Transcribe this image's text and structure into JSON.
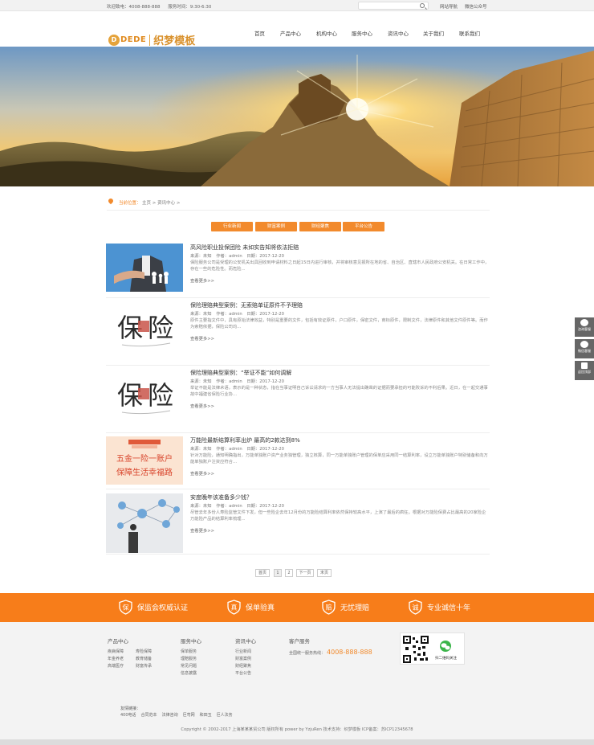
{
  "topbar": {
    "hotline_label": "欢迎致电：4008-888-888",
    "hours_label": "服务时间：9:30-6:30",
    "sitemap": "网站导航",
    "wechat": "微信公众号"
  },
  "header": {
    "logo_badge": "D",
    "logo_en": "DEDE",
    "logo_cn": "织梦模板"
  },
  "nav": [
    "首页",
    "产品中心",
    "机构中心",
    "服务中心",
    "资讯中心",
    "关于我们",
    "联系我们"
  ],
  "breadcrumb": {
    "label": "当前位置：",
    "path": "主页 > 资讯中心 >"
  },
  "categories": [
    "行业新闻",
    "财富案例",
    "财经聚焦",
    "平台公告"
  ],
  "articles": [
    {
      "title": "高风险职业投保团险 未如实告知将依法拒赔",
      "source": "来源：未知",
      "author": "作者：admin",
      "date": "日期：2017-12-20",
      "desc": "保险服务公司是受理的公安机关出具回收到申请材料之日起15日内进行审核，并将审核意见报所在地的省、自治区、直辖市人民政府公安机关。在日常工作中，存在一些的危险性。而危险...",
      "more": "查看更多>>"
    },
    {
      "title": "保险理赔典型案例：无索赔单证原件不予理赔",
      "source": "来源：未知",
      "author": "作者：admin",
      "date": "日期：2017-12-20",
      "desc": "原件主要指文件中，具有原始法律效益，特别是重要的文件，包括有效证原件，户口原件，保密文件，商标原件，限制文件，法律原件和其他文件原件等。而作为索赔依据，保险公司均...",
      "more": "查看更多>>"
    },
    {
      "title": "保险理赔典型案例：“举证不能”如何调解",
      "source": "来源：未知",
      "author": "作者：admin",
      "date": "日期：2017-12-20",
      "desc": "举证不能是法律术语，表示的是一种状态，指在当事证明自己诉讼请求的一方当事人无法提出确凿的证据而要承担的可能败诉的不利后果。近日，在一起交通事故中福建省保险行业协...",
      "more": "查看更多>>"
    },
    {
      "title": "万能险最新结算利率出炉 最高的2款达到8%",
      "source": "来源：未知",
      "author": "作者：admin",
      "date": "日期：2017-12-20",
      "desc": "针对万能险，通知明确指出，万能单独账户资产业务独管理，独立核算，同一万能单独账户管理的保单应采用同一结算利率，设立万能单独账户特别储备和向万能单独账户注资应符合...",
      "more": "查看更多>>"
    },
    {
      "title": "安度晚年该准备多少钱？",
      "source": "来源：未知",
      "author": "作者：admin",
      "date": "日期：2017-12-20",
      "desc": "尽管去年多份人寿险监管文件下发，但一些险企去年12月份的万能险结算利率依然保持较高水平，上演了最后的疯狂。根据对万能险保费占比最高的20家险企万能险产品的结算利率梳理...",
      "more": "查看更多>>"
    }
  ],
  "pagination": [
    "首页",
    "1",
    "2",
    "下一页",
    "末页"
  ],
  "promo": [
    {
      "icon": "保",
      "label": "保监会权威认证"
    },
    {
      "icon": "真",
      "label": "保单验真"
    },
    {
      "icon": "赔",
      "label": "无忧理赔"
    },
    {
      "icon": "诚",
      "label": "专业诚信十年"
    }
  ],
  "footer": {
    "products": {
      "title": "产品中心",
      "links": [
        "疾病保障",
        "寿险保障",
        "年金养老",
        "教育储备",
        "高端医疗",
        "财富传承"
      ]
    },
    "services": {
      "title": "服务中心",
      "links": [
        "保单服务",
        "理赔服务",
        "常见问题",
        "信息披露"
      ]
    },
    "news": {
      "title": "资讯中心",
      "links": [
        "行业新闻",
        "财富案例",
        "财经聚焦",
        "平台公告"
      ]
    },
    "customer": {
      "title": "客户服务",
      "hotline_label": "全国统一服务热线：",
      "phone": "4008-888-888"
    },
    "qr_caption": "扫二维码关注",
    "friend_title": "友情链接：",
    "friend_links": [
      "400电话",
      "合同范本",
      "法律咨询",
      "巨弯网",
      "和田玉",
      "巨人法务"
    ],
    "copyright": "Copyright © 2002-2017 上海某某某贸公司 版权所有 power by YzjuRen   技术支持：织梦模板   ICP备案：苏ICP12345678"
  },
  "sidebar": [
    "咨询客服",
    "微信客服",
    "返回顶部"
  ],
  "colors": {
    "accent": "#f77d1a",
    "footer_bg": "#f3f3f3"
  }
}
